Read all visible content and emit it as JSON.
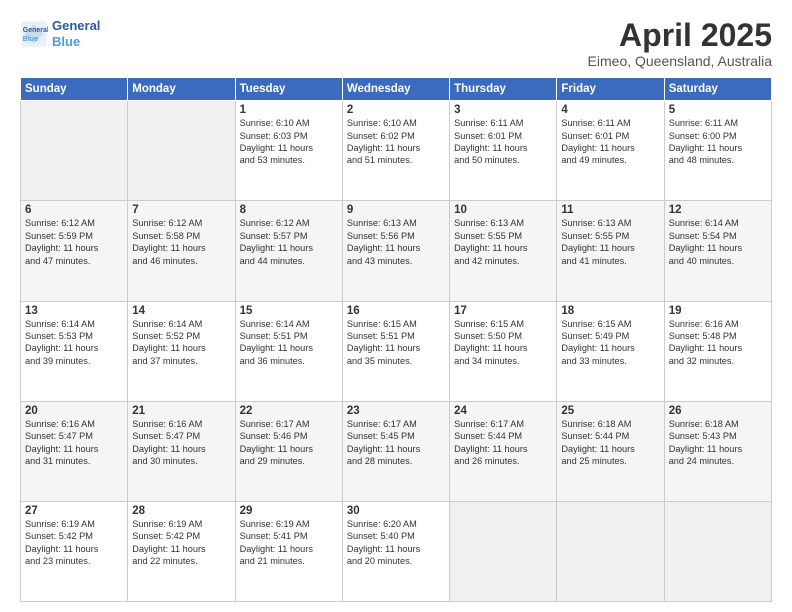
{
  "header": {
    "logo_line1": "General",
    "logo_line2": "Blue",
    "month": "April 2025",
    "location": "Eimeo, Queensland, Australia"
  },
  "weekdays": [
    "Sunday",
    "Monday",
    "Tuesday",
    "Wednesday",
    "Thursday",
    "Friday",
    "Saturday"
  ],
  "weeks": [
    [
      {
        "day": "",
        "detail": ""
      },
      {
        "day": "",
        "detail": ""
      },
      {
        "day": "1",
        "detail": "Sunrise: 6:10 AM\nSunset: 6:03 PM\nDaylight: 11 hours\nand 53 minutes."
      },
      {
        "day": "2",
        "detail": "Sunrise: 6:10 AM\nSunset: 6:02 PM\nDaylight: 11 hours\nand 51 minutes."
      },
      {
        "day": "3",
        "detail": "Sunrise: 6:11 AM\nSunset: 6:01 PM\nDaylight: 11 hours\nand 50 minutes."
      },
      {
        "day": "4",
        "detail": "Sunrise: 6:11 AM\nSunset: 6:01 PM\nDaylight: 11 hours\nand 49 minutes."
      },
      {
        "day": "5",
        "detail": "Sunrise: 6:11 AM\nSunset: 6:00 PM\nDaylight: 11 hours\nand 48 minutes."
      }
    ],
    [
      {
        "day": "6",
        "detail": "Sunrise: 6:12 AM\nSunset: 5:59 PM\nDaylight: 11 hours\nand 47 minutes."
      },
      {
        "day": "7",
        "detail": "Sunrise: 6:12 AM\nSunset: 5:58 PM\nDaylight: 11 hours\nand 46 minutes."
      },
      {
        "day": "8",
        "detail": "Sunrise: 6:12 AM\nSunset: 5:57 PM\nDaylight: 11 hours\nand 44 minutes."
      },
      {
        "day": "9",
        "detail": "Sunrise: 6:13 AM\nSunset: 5:56 PM\nDaylight: 11 hours\nand 43 minutes."
      },
      {
        "day": "10",
        "detail": "Sunrise: 6:13 AM\nSunset: 5:55 PM\nDaylight: 11 hours\nand 42 minutes."
      },
      {
        "day": "11",
        "detail": "Sunrise: 6:13 AM\nSunset: 5:55 PM\nDaylight: 11 hours\nand 41 minutes."
      },
      {
        "day": "12",
        "detail": "Sunrise: 6:14 AM\nSunset: 5:54 PM\nDaylight: 11 hours\nand 40 minutes."
      }
    ],
    [
      {
        "day": "13",
        "detail": "Sunrise: 6:14 AM\nSunset: 5:53 PM\nDaylight: 11 hours\nand 39 minutes."
      },
      {
        "day": "14",
        "detail": "Sunrise: 6:14 AM\nSunset: 5:52 PM\nDaylight: 11 hours\nand 37 minutes."
      },
      {
        "day": "15",
        "detail": "Sunrise: 6:14 AM\nSunset: 5:51 PM\nDaylight: 11 hours\nand 36 minutes."
      },
      {
        "day": "16",
        "detail": "Sunrise: 6:15 AM\nSunset: 5:51 PM\nDaylight: 11 hours\nand 35 minutes."
      },
      {
        "day": "17",
        "detail": "Sunrise: 6:15 AM\nSunset: 5:50 PM\nDaylight: 11 hours\nand 34 minutes."
      },
      {
        "day": "18",
        "detail": "Sunrise: 6:15 AM\nSunset: 5:49 PM\nDaylight: 11 hours\nand 33 minutes."
      },
      {
        "day": "19",
        "detail": "Sunrise: 6:16 AM\nSunset: 5:48 PM\nDaylight: 11 hours\nand 32 minutes."
      }
    ],
    [
      {
        "day": "20",
        "detail": "Sunrise: 6:16 AM\nSunset: 5:47 PM\nDaylight: 11 hours\nand 31 minutes."
      },
      {
        "day": "21",
        "detail": "Sunrise: 6:16 AM\nSunset: 5:47 PM\nDaylight: 11 hours\nand 30 minutes."
      },
      {
        "day": "22",
        "detail": "Sunrise: 6:17 AM\nSunset: 5:46 PM\nDaylight: 11 hours\nand 29 minutes."
      },
      {
        "day": "23",
        "detail": "Sunrise: 6:17 AM\nSunset: 5:45 PM\nDaylight: 11 hours\nand 28 minutes."
      },
      {
        "day": "24",
        "detail": "Sunrise: 6:17 AM\nSunset: 5:44 PM\nDaylight: 11 hours\nand 26 minutes."
      },
      {
        "day": "25",
        "detail": "Sunrise: 6:18 AM\nSunset: 5:44 PM\nDaylight: 11 hours\nand 25 minutes."
      },
      {
        "day": "26",
        "detail": "Sunrise: 6:18 AM\nSunset: 5:43 PM\nDaylight: 11 hours\nand 24 minutes."
      }
    ],
    [
      {
        "day": "27",
        "detail": "Sunrise: 6:19 AM\nSunset: 5:42 PM\nDaylight: 11 hours\nand 23 minutes."
      },
      {
        "day": "28",
        "detail": "Sunrise: 6:19 AM\nSunset: 5:42 PM\nDaylight: 11 hours\nand 22 minutes."
      },
      {
        "day": "29",
        "detail": "Sunrise: 6:19 AM\nSunset: 5:41 PM\nDaylight: 11 hours\nand 21 minutes."
      },
      {
        "day": "30",
        "detail": "Sunrise: 6:20 AM\nSunset: 5:40 PM\nDaylight: 11 hours\nand 20 minutes."
      },
      {
        "day": "",
        "detail": ""
      },
      {
        "day": "",
        "detail": ""
      },
      {
        "day": "",
        "detail": ""
      }
    ]
  ]
}
